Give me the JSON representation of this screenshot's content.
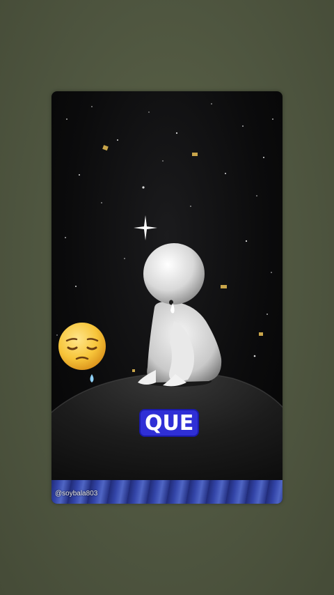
{
  "video": {
    "caption": "QUE",
    "watermark": "@soybala803"
  },
  "colors": {
    "page_background": "#545b44",
    "caption_background": "#2f2fd6",
    "caption_text": "#ffffff",
    "bar_accent": "#3a4fc4"
  },
  "icons": {
    "emoji": "pensive-face-icon",
    "sparkle": "sparkle-star-icon"
  }
}
